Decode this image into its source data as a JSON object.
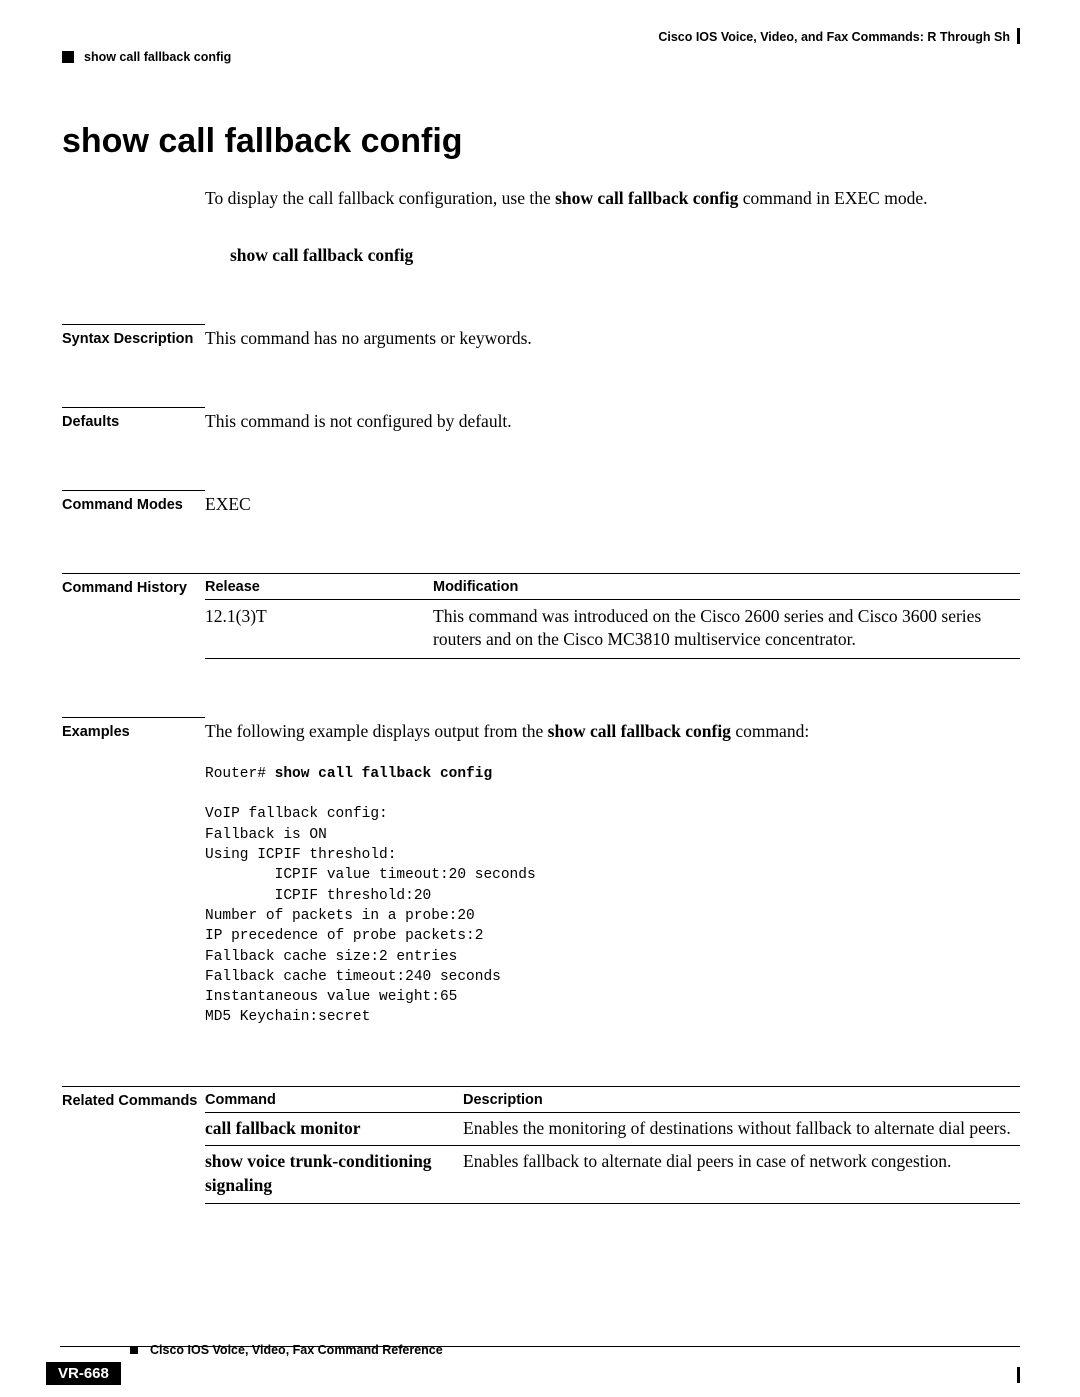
{
  "header": {
    "chapter": "Cisco IOS Voice, Video, and Fax Commands: R Through Sh",
    "topic": "show call fallback config"
  },
  "title": "show call fallback config",
  "intro": {
    "pre": "To display the call fallback configuration, use the ",
    "cmd": "show call fallback config",
    "post": " command in EXEC mode."
  },
  "syntax_line": "show call fallback config",
  "sections": {
    "syntax_desc": {
      "label": "Syntax Description",
      "body": "This command has no arguments or keywords."
    },
    "defaults": {
      "label": "Defaults",
      "body": "This command is not configured by default."
    },
    "modes": {
      "label": "Command Modes",
      "body": "EXEC"
    },
    "history": {
      "label": "Command History",
      "head_release": "Release",
      "head_mod": "Modification",
      "rows": [
        {
          "release": "12.1(3)T",
          "mod": "This command was introduced on the Cisco 2600 series and Cisco 3600 series routers and on the Cisco MC3810 multiservice concentrator."
        }
      ]
    },
    "examples": {
      "label": "Examples",
      "intro_pre": "The following example displays output from the ",
      "intro_cmd": "show call fallback config",
      "intro_post": " command:",
      "code_prompt": "Router# ",
      "code_cmd": "show call fallback config",
      "code_body": "VoIP fallback config:\nFallback is ON\nUsing ICPIF threshold:\n        ICPIF value timeout:20 seconds\n        ICPIF threshold:20\nNumber of packets in a probe:20\nIP precedence of probe packets:2\nFallback cache size:2 entries\nFallback cache timeout:240 seconds\nInstantaneous value weight:65\nMD5 Keychain:secret"
    },
    "related": {
      "label": "Related Commands",
      "head_cmd": "Command",
      "head_desc": "Description",
      "rows": [
        {
          "cmd": "call fallback monitor",
          "desc": "Enables the monitoring of destinations without fallback to alternate dial peers."
        },
        {
          "cmd": "show voice trunk-conditioning signaling",
          "desc": "Enables fallback to alternate dial peers in case of network congestion."
        }
      ]
    }
  },
  "footer": {
    "doc_title": "Cisco IOS Voice, Video, Fax Command Reference",
    "page_num": "VR-668"
  }
}
